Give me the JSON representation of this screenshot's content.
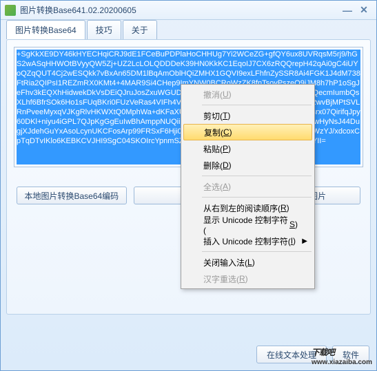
{
  "window": {
    "title": "图片转换Base641.02.20200605"
  },
  "tabs": {
    "t1": "图片转换Base64",
    "t2": "技巧",
    "t3": "关于"
  },
  "textarea": {
    "value": "+SgKkXE9DY46kHYECHqiCRJ9dE1FCeBuPDPlaHoCHHUg7Yi2WCeZG+gfQY6ux8UVRqsM5rj9/hGS2wASqHHWOtBVyyQW5Zj+UZ2LcLOLQDDDeK39HN0KkKC1EqoIJ7CX6zRQQrepH42qAi0gC4iUYoQZqQUT4Cj2wESQkk7vBxAn65DM1lBqAmOblHQiZMHX1GQVI9exLFhfnZySSR8Ai4FGK1J4dM738FtRia2QIPsI1REZmRX0KMt4+4MAR9Si4CHep9ImYNW0BCRoWzZK8fnTsoyPszeQ9jJM8h7hP1oSgJeFhv3kEQXhHidwekDkVsDEiQJruJosZxuWGUDGRptVqkxgRR5UE0gVgdnBfOUPAJa7QecmIumbQsXLhf6BfrSOk6Ho1sFUqBKri0FUzVeRas4VIFh4V8RFCPscvB5QDtAe4YjaLjE6khzcHXQ2wvBjMPtSVLRnPveeMyxqVJKgRlvHKWXtQ0MphWa+dKFaXUFXYbsIT3AslQm6xbfihgZIE7ZBXiaR2srx07QirifqJpy60DKl+niyu4iGPL7QJpKgGgEuIwBhAmppNUQiiKkH6YdNdAsJ9HnqBJSxvvO8dQnOH6wHyNsJ44DugjXJdehGuYxAsoLcynUKCFosArp99FRSxF6Hji0IVMFZPrVe/J7DXde1eJsvFRYRFYsnFWzYJ/xdcoxCpTqDTvIKlo6KEBKCVJHI9SgC04SKOIrcYpnmSZZuH6G9Y5xOb1HAAAAASUVORK5CYII="
  },
  "buttons": {
    "b1": "本地图片转换Base64编码",
    "b2": "图",
    "b3": "码转换图片"
  },
  "bottom": {
    "b1": "在线文本处理",
    "b2": "软件"
  },
  "ctx": {
    "undo": "撤消(",
    "undo_k": "U",
    "cut": "剪切(",
    "cut_k": "T",
    "copy": "复制(",
    "copy_k": "C",
    "paste": "粘贴(",
    "paste_k": "P",
    "delete": "删除(",
    "delete_k": "D",
    "selectall": "全选(",
    "selectall_k": "A",
    "rtl": "从右到左的阅读顺序(",
    "rtl_k": "R",
    "showctrl": "显示 Unicode 控制字符(",
    "showctrl_k": "S",
    "insertctrl": "插入 Unicode 控制字符(",
    "insertctrl_k": "I",
    "closeime": "关闭输入法(",
    "closeime_k": "L",
    "hanzi": "汉字重选(",
    "hanzi_k": "R",
    "close_paren": ")"
  },
  "watermark": {
    "main": "下载吧",
    "sub": "www.xiazaiba.com"
  }
}
